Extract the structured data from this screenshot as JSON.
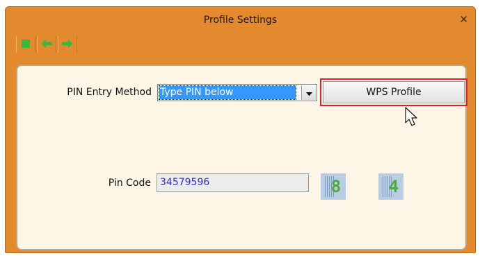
{
  "window": {
    "title": "Profile Settings",
    "close_glyph": "✕",
    "toolbar": [
      {
        "name": "stop-icon",
        "color": "#3cb83c"
      },
      {
        "name": "back-arrow-icon",
        "color": "#3cb83c"
      },
      {
        "name": "forward-arrow-icon",
        "color": "#3cb83c"
      }
    ]
  },
  "form": {
    "pin_method_label": "PIN Entry Method",
    "pin_method_value": "Type PIN below",
    "wps_button": "WPS Profile",
    "pin_code_label": "Pin Code",
    "pin_code_value": "34579596",
    "captcha_digits": [
      "8",
      "4"
    ]
  },
  "colors": {
    "title_bar": "#e48a2e",
    "content_bg": "#fdf5e6",
    "highlight": "#e0202a",
    "selection": "#3399ff"
  }
}
